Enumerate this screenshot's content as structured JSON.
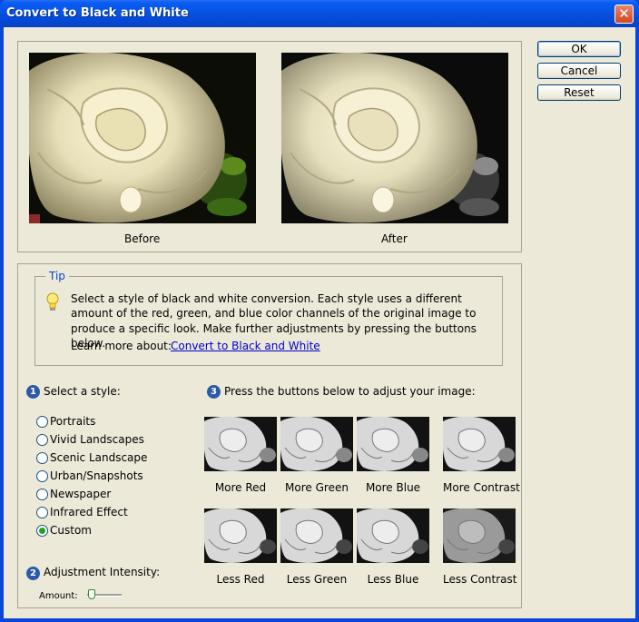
{
  "window": {
    "title": "Convert to Black and White"
  },
  "buttons": {
    "ok": "OK",
    "cancel": "Cancel",
    "reset": "Reset"
  },
  "preview": {
    "before_label": "Before",
    "after_label": "After"
  },
  "tip": {
    "title": "Tip",
    "text": "Select a style of black and white conversion. Each style uses a different amount of the red, green, and blue color channels of the original image to produce a specific look. Make further adjustments by pressing the buttons below.",
    "learn_more_label": "Learn more about:",
    "learn_more_link": "Convert to Black and White"
  },
  "styles": {
    "step": "1",
    "heading": "Select a style:",
    "options": [
      "Portraits",
      "Vivid Landscapes",
      "Scenic Landscape",
      "Urban/Snapshots",
      "Newspaper",
      "Infrared Effect",
      "Custom"
    ],
    "selected": "Custom"
  },
  "adjust": {
    "step": "3",
    "heading": "Press the buttons below to adjust your image:",
    "more": [
      "More Red",
      "More Green",
      "More Blue",
      "More Contrast"
    ],
    "less": [
      "Less Red",
      "Less Green",
      "Less Blue",
      "Less Contrast"
    ]
  },
  "intensity": {
    "step": "2",
    "heading": "Adjustment Intensity:",
    "amount_label": "Amount:",
    "amount_fraction": 0.05
  },
  "colors": {
    "title_bar": "#0551e0",
    "dialog_bg": "#ece9d8",
    "link": "#0000cc",
    "tip_title": "#0046d5"
  }
}
